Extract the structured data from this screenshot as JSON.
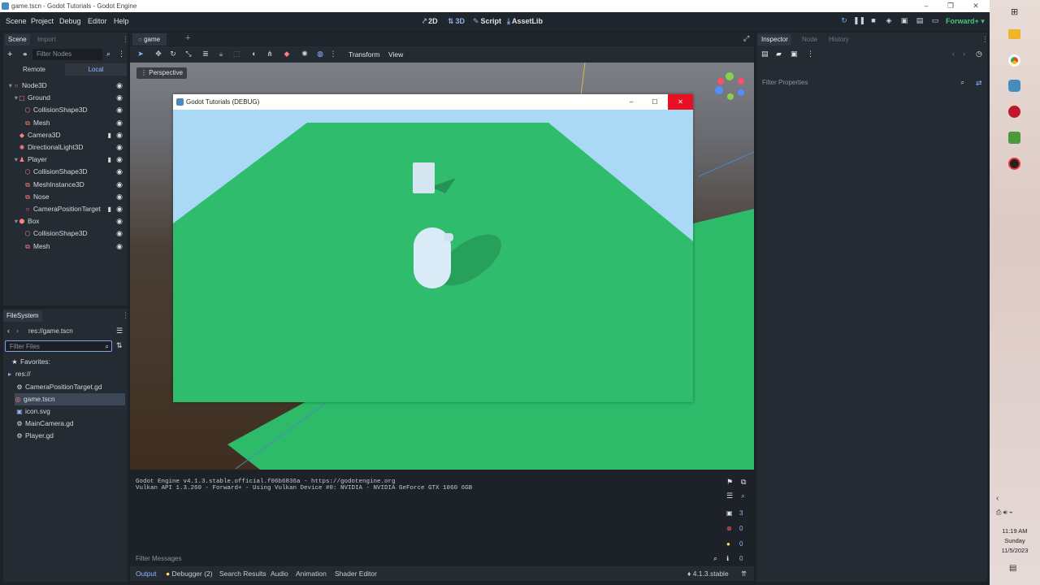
{
  "window": {
    "title": "game.tscn - Godot Tutorials - Godot Engine"
  },
  "menu": [
    "Scene",
    "Project",
    "Debug",
    "Editor",
    "Help"
  ],
  "modes": [
    "2D",
    "3D",
    "Script",
    "AssetLib"
  ],
  "renderer": "Forward+",
  "scene_dock": {
    "tabs": [
      "Scene",
      "Import"
    ],
    "filter_placeholder": "Filter Nodes",
    "remote_label": "Remote",
    "local_label": "Local",
    "nodes": [
      {
        "label": "Node3D",
        "icon": "node3d-icon",
        "color": "#fc7f7f"
      },
      {
        "label": "Ground",
        "icon": "static-body-icon",
        "color": "#fc7f7f"
      },
      {
        "label": "CollisionShape3D",
        "icon": "collision-shape-icon",
        "color": "#fc7f7f"
      },
      {
        "label": "Mesh",
        "icon": "mesh-icon",
        "color": "#fc7f7f"
      },
      {
        "label": "Camera3D",
        "icon": "camera-icon",
        "color": "#fc7f7f"
      },
      {
        "label": "DirectionalLight3D",
        "icon": "light-icon",
        "color": "#fc7f7f"
      },
      {
        "label": "Player",
        "icon": "character-body-icon",
        "color": "#fc7f7f"
      },
      {
        "label": "CollisionShape3D",
        "icon": "collision-shape-icon",
        "color": "#fc7f7f"
      },
      {
        "label": "MeshInstance3D",
        "icon": "mesh-icon",
        "color": "#fc7f7f"
      },
      {
        "label": "Nose",
        "icon": "mesh-icon",
        "color": "#fc7f7f"
      },
      {
        "label": "CameraPositionTarget",
        "icon": "marker-icon",
        "color": "#fc7f7f"
      },
      {
        "label": "Box",
        "icon": "rigid-body-icon",
        "color": "#fc7f7f"
      },
      {
        "label": "CollisionShape3D",
        "icon": "collision-shape-icon",
        "color": "#fc7f7f"
      },
      {
        "label": "Mesh",
        "icon": "mesh-icon",
        "color": "#fc7f7f"
      }
    ]
  },
  "filesystem": {
    "title": "FileSystem",
    "path": "res://game.tscn",
    "filter_placeholder": "Filter Files",
    "favorites_label": "Favorites:",
    "root_label": "res://",
    "files": [
      "CameraPositionTarget.gd",
      "game.tscn",
      "icon.svg",
      "MainCamera.gd",
      "Player.gd"
    ]
  },
  "editor": {
    "tab": "game",
    "toolbar": [
      "Transform",
      "View"
    ],
    "perspective_label": "Perspective"
  },
  "game_window": {
    "title": "Godot Tutorials (DEBUG)"
  },
  "inspector": {
    "tabs": [
      "Inspector",
      "Node",
      "History"
    ],
    "filter_placeholder": "Filter Properties"
  },
  "output": {
    "lines": [
      "Godot Engine v4.1.3.stable.official.f06b6836a - https://godotengine.org",
      "Vulkan API 1.3.260 - Forward+ - Using Vulkan Device #0: NVIDIA - NVIDIA GeForce GTX 1060 6GB"
    ],
    "filter_placeholder": "Filter Messages",
    "counts": [
      "3",
      "0",
      "0",
      "0"
    ]
  },
  "bottom_tabs": [
    "Output",
    "Debugger (2)",
    "Search Results",
    "Audio",
    "Animation",
    "Shader Editor"
  ],
  "version": "4.1.3.stable",
  "clock": {
    "time": "11:19 AM",
    "day": "Sunday",
    "date": "11/5/2023"
  }
}
